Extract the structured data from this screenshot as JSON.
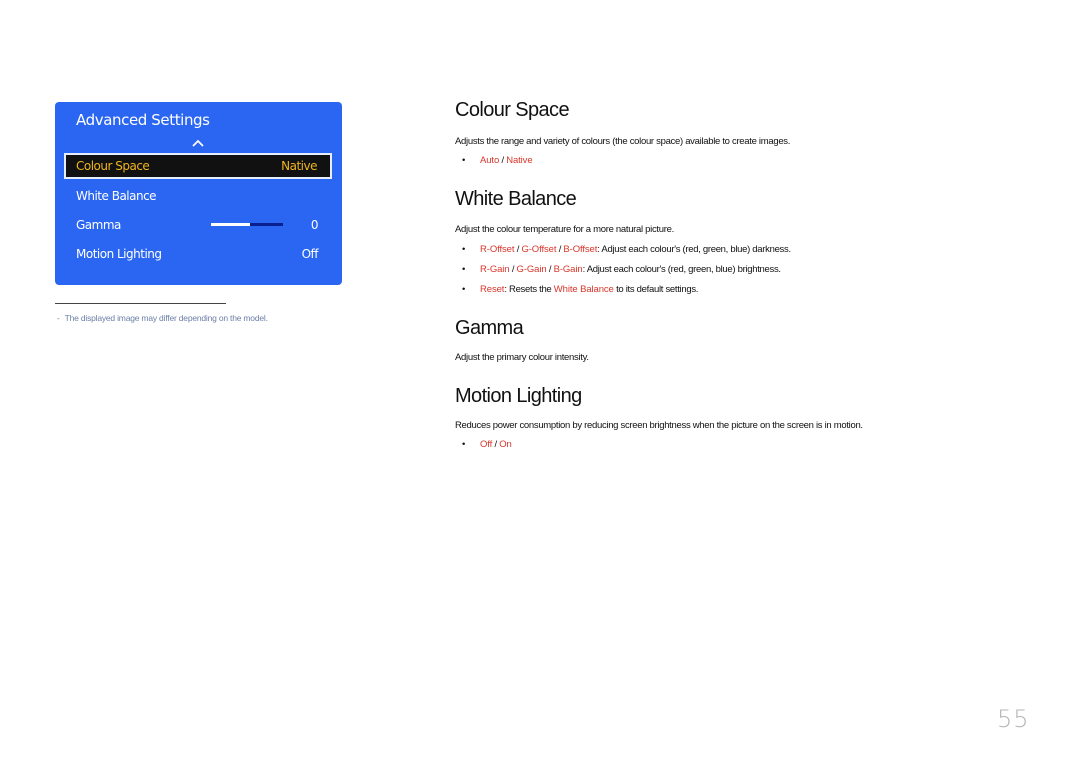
{
  "osd": {
    "title": "Advanced Settings",
    "chevron_icon": "chevron-up-icon",
    "rows": [
      {
        "label": "Colour Space",
        "value": "Native",
        "selected": true
      },
      {
        "label": "White Balance",
        "value": ""
      },
      {
        "label": "Gamma",
        "value": "0",
        "slider_fraction": 0.54
      },
      {
        "label": "Motion Lighting",
        "value": "Off"
      }
    ],
    "colors": {
      "background": "#2a66f2",
      "selected_text": "#f0b51e",
      "selected_bg": "#111111"
    }
  },
  "footnote": {
    "dash": "-",
    "text": "The displayed image may differ depending on the model."
  },
  "sections": {
    "colour_space": {
      "title": "Colour Space",
      "description": "Adjusts the range and variety of colours (the colour space) available to create images.",
      "options": {
        "a": "Auto",
        "sep": " / ",
        "b": "Native"
      }
    },
    "white_balance": {
      "title": "White Balance",
      "description": "Adjust the colour temperature for a more natural picture.",
      "bullet1": {
        "r": "R-Offset",
        "g": "G-Offset",
        "b": "B-Offset",
        "sep": " / ",
        "text": ": Adjust each colour's (red, green, blue) darkness."
      },
      "bullet2": {
        "r": "R-Gain",
        "g": "G-Gain",
        "b": "B-Gain",
        "sep": " / ",
        "text": ": Adjust each colour's (red, green, blue) brightness."
      },
      "bullet3": {
        "reset": "Reset",
        "text1": ": Resets the ",
        "wb": "White Balance",
        "text2": " to its default settings."
      }
    },
    "gamma": {
      "title": "Gamma",
      "description": "Adjust the primary colour intensity."
    },
    "motion_lighting": {
      "title": "Motion Lighting",
      "description": "Reduces power consumption by reducing screen brightness when the picture on the screen is in motion.",
      "options": {
        "a": "Off",
        "sep": " / ",
        "b": "On"
      }
    }
  },
  "bullet_glyph": "•",
  "accent_color": "#d9362b",
  "page_number": "55"
}
